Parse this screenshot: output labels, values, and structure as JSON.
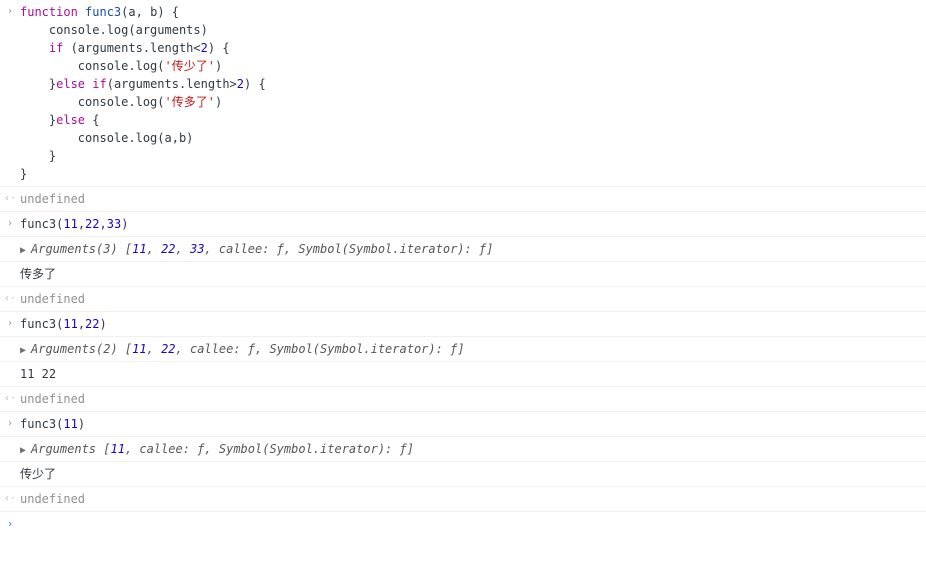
{
  "entries": [
    {
      "kind": "input-code",
      "tokens": [
        {
          "t": "kw",
          "v": "function"
        },
        {
          "t": "",
          "v": " "
        },
        {
          "t": "fn",
          "v": "func3"
        },
        {
          "t": "",
          "v": "("
        },
        {
          "t": "",
          "v": "a"
        },
        {
          "t": "",
          "v": ", "
        },
        {
          "t": "",
          "v": "b"
        },
        {
          "t": "",
          "v": ") {\n"
        },
        {
          "t": "",
          "v": "    console.log("
        },
        {
          "t": "",
          "v": "arguments"
        },
        {
          "t": "",
          "v": ")\n"
        },
        {
          "t": "",
          "v": "    "
        },
        {
          "t": "kw",
          "v": "if"
        },
        {
          "t": "",
          "v": " (arguments.length<"
        },
        {
          "t": "num",
          "v": "2"
        },
        {
          "t": "",
          "v": ") {\n"
        },
        {
          "t": "",
          "v": "        console.log("
        },
        {
          "t": "str",
          "v": "'传少了'"
        },
        {
          "t": "",
          "v": ")\n"
        },
        {
          "t": "",
          "v": "    }"
        },
        {
          "t": "kw",
          "v": "else"
        },
        {
          "t": "",
          "v": " "
        },
        {
          "t": "kw",
          "v": "if"
        },
        {
          "t": "",
          "v": "(arguments.length>"
        },
        {
          "t": "num",
          "v": "2"
        },
        {
          "t": "",
          "v": ") {\n"
        },
        {
          "t": "",
          "v": "        console.log("
        },
        {
          "t": "str",
          "v": "'传多了'"
        },
        {
          "t": "",
          "v": ")\n"
        },
        {
          "t": "",
          "v": "    }"
        },
        {
          "t": "kw",
          "v": "else"
        },
        {
          "t": "",
          "v": " {\n"
        },
        {
          "t": "",
          "v": "        console.log(a,b)\n"
        },
        {
          "t": "",
          "v": "    }\n"
        },
        {
          "t": "",
          "v": "}"
        }
      ]
    },
    {
      "kind": "result-undefined",
      "text": "undefined"
    },
    {
      "kind": "input-code",
      "tokens": [
        {
          "t": "",
          "v": "func3("
        },
        {
          "t": "num",
          "v": "11"
        },
        {
          "t": "",
          "v": ","
        },
        {
          "t": "num",
          "v": "22"
        },
        {
          "t": "",
          "v": ","
        },
        {
          "t": "num",
          "v": "33"
        },
        {
          "t": "",
          "v": ")"
        }
      ]
    },
    {
      "kind": "log-arguments",
      "tokens": [
        {
          "t": "argobj",
          "v": "Arguments(3) ["
        },
        {
          "t": "argnum",
          "v": "11"
        },
        {
          "t": "argobj",
          "v": ", "
        },
        {
          "t": "argnum",
          "v": "22"
        },
        {
          "t": "argobj",
          "v": ", "
        },
        {
          "t": "argnum",
          "v": "33"
        },
        {
          "t": "argobj",
          "v": ", callee: "
        },
        {
          "t": "argf",
          "v": "ƒ"
        },
        {
          "t": "argobj",
          "v": ", Symbol(Symbol.iterator): "
        },
        {
          "t": "argf",
          "v": "ƒ"
        },
        {
          "t": "argobj",
          "v": "]"
        }
      ]
    },
    {
      "kind": "log-text",
      "text": "传多了"
    },
    {
      "kind": "result-undefined",
      "text": "undefined"
    },
    {
      "kind": "input-code",
      "tokens": [
        {
          "t": "",
          "v": "func3("
        },
        {
          "t": "num",
          "v": "11"
        },
        {
          "t": "",
          "v": ","
        },
        {
          "t": "num",
          "v": "22"
        },
        {
          "t": "",
          "v": ")"
        }
      ]
    },
    {
      "kind": "log-arguments",
      "tokens": [
        {
          "t": "argobj",
          "v": "Arguments(2) ["
        },
        {
          "t": "argnum",
          "v": "11"
        },
        {
          "t": "argobj",
          "v": ", "
        },
        {
          "t": "argnum",
          "v": "22"
        },
        {
          "t": "argobj",
          "v": ", callee: "
        },
        {
          "t": "argf",
          "v": "ƒ"
        },
        {
          "t": "argobj",
          "v": ", Symbol(Symbol.iterator): "
        },
        {
          "t": "argf",
          "v": "ƒ"
        },
        {
          "t": "argobj",
          "v": "]"
        }
      ]
    },
    {
      "kind": "log-text",
      "text": "11 22"
    },
    {
      "kind": "result-undefined",
      "text": "undefined"
    },
    {
      "kind": "input-code",
      "tokens": [
        {
          "t": "",
          "v": "func3("
        },
        {
          "t": "num",
          "v": "11"
        },
        {
          "t": "",
          "v": ")"
        }
      ]
    },
    {
      "kind": "log-arguments",
      "tokens": [
        {
          "t": "argobj",
          "v": "Arguments ["
        },
        {
          "t": "argnum",
          "v": "11"
        },
        {
          "t": "argobj",
          "v": ", callee: "
        },
        {
          "t": "argf",
          "v": "ƒ"
        },
        {
          "t": "argobj",
          "v": ", Symbol(Symbol.iterator): "
        },
        {
          "t": "argf",
          "v": "ƒ"
        },
        {
          "t": "argobj",
          "v": "]"
        }
      ]
    },
    {
      "kind": "log-text",
      "text": "传少了"
    },
    {
      "kind": "result-undefined",
      "text": "undefined"
    }
  ],
  "markers": {
    "input": "›",
    "output": "‹·",
    "disclosure": "▶"
  }
}
